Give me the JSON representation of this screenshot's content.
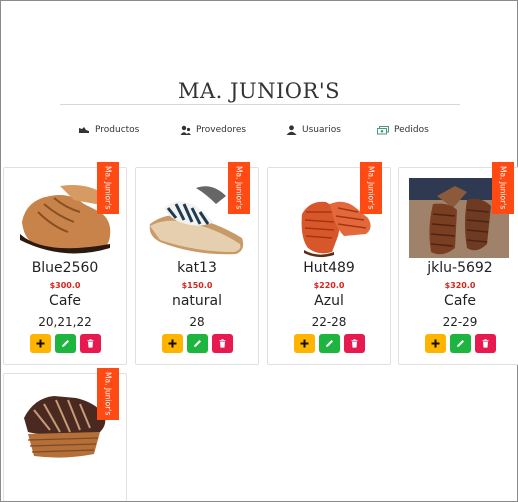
{
  "header": {
    "brand": "MA. JUNIOR'S"
  },
  "nav": [
    {
      "label": "Productos",
      "icon": "shoe-icon"
    },
    {
      "label": "Provedores",
      "icon": "users-icon"
    },
    {
      "label": "Usuarios",
      "icon": "user-icon"
    },
    {
      "label": "Pedidos",
      "icon": "money-icon"
    }
  ],
  "badge_text": "Ma. Junior's",
  "colors": {
    "ribbon": "#ff4a14",
    "price": "#d8261d",
    "add": "#ffb400",
    "edit": "#1db53f",
    "delete": "#e8194f"
  },
  "products": [
    {
      "code": "Blue2560",
      "price": "$300.0",
      "color": "Cafe",
      "sizes": "20,21,22"
    },
    {
      "code": "kat13",
      "price": "$150.0",
      "color": "natural",
      "sizes": "28"
    },
    {
      "code": "Hut489",
      "price": "$220.0",
      "color": "Azul",
      "sizes": "22-28"
    },
    {
      "code": "jklu-5692",
      "price": "$320.0",
      "color": "Cafe",
      "sizes": "22-29"
    },
    {
      "code": "",
      "price": "",
      "color": "",
      "sizes": ""
    }
  ]
}
